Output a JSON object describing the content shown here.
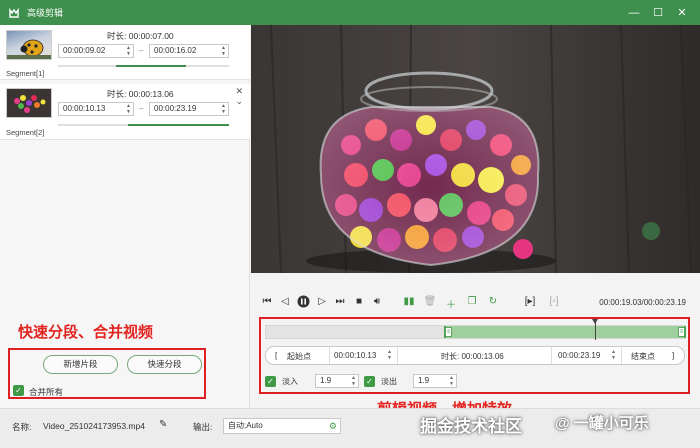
{
  "window": {
    "title": "高级剪辑",
    "minimize": "—",
    "maximize": "☐",
    "close": "✕"
  },
  "segments": [
    {
      "label": "Segment[1]",
      "duration_label": "时长:",
      "duration": "00:00:07.00",
      "start": "00:00:09.02",
      "end": "00:00:16.02",
      "dash": "–"
    },
    {
      "label": "Segment[2]",
      "duration_label": "时长:",
      "duration": "00:00:13.06",
      "start": "00:00:10.13",
      "end": "00:00:23.19",
      "dash": "–",
      "close_icon": "✕",
      "move_icon": "⌄"
    }
  ],
  "annotations": {
    "left": "快速分段、合并视频",
    "right": "剪辑视频，增加特效"
  },
  "left_buttons": {
    "new_segment": "新增片段",
    "quick_split": "快速分段",
    "merge_all": "合并所有"
  },
  "player": {
    "time_display": "00:00:19.03/00:00:23.19"
  },
  "trim": {
    "start_btn": "起始点",
    "start_bracket": "[",
    "start_time": "00:00:10.13",
    "duration_label": "时长:",
    "duration": "00:00:13.06",
    "end_time": "00:00:23.19",
    "end_btn": "结束点",
    "end_bracket": "]"
  },
  "fade": {
    "fade_in_label": "淡入",
    "fade_in_value": "1.9",
    "fade_out_label": "淡出",
    "fade_out_value": "1.9"
  },
  "bottom": {
    "name_label": "名称:",
    "filename": "Video_251024173953.mp4",
    "output_label": "输出:",
    "output_value": "自动;Auto"
  },
  "watermark": {
    "left": "掘金技术社区",
    "right": "@ 一罐小可乐"
  },
  "colors": {
    "accent": "#3f8f4e",
    "annotation_red": "#e02020"
  }
}
